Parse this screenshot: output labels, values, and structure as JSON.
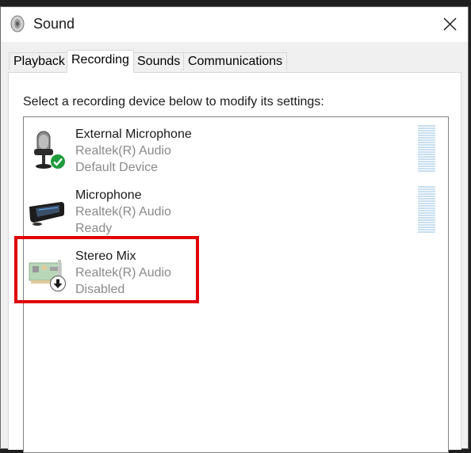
{
  "window": {
    "title": "Sound",
    "title_icon": "speaker-icon",
    "close_icon": "close-icon"
  },
  "tabs": [
    {
      "label": "Playback",
      "active": false
    },
    {
      "label": "Recording",
      "active": true
    },
    {
      "label": "Sounds",
      "active": false
    },
    {
      "label": "Communications",
      "active": false
    }
  ],
  "recording": {
    "instruction": "Select a recording device below to modify its settings:",
    "devices": [
      {
        "name": "External Microphone",
        "driver": "Realtek(R) Audio",
        "status": "Default Device",
        "icon": "external-microphone-icon",
        "badge": "default-check-icon"
      },
      {
        "name": "Microphone",
        "driver": "Realtek(R) Audio",
        "status": "Ready",
        "icon": "microphone-icon",
        "badge": ""
      },
      {
        "name": "Stereo Mix",
        "driver": "Realtek(R) Audio",
        "status": "Disabled",
        "icon": "sound-card-icon",
        "badge": "disabled-arrow-icon"
      }
    ]
  },
  "colors": {
    "highlight": "#e00000",
    "meter": "#c8dff0",
    "check_badge": "#1e9b3c"
  }
}
